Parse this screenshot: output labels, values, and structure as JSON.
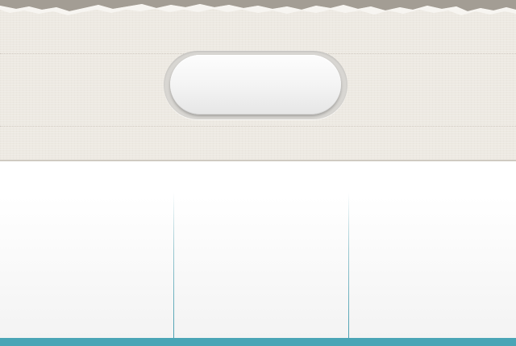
{
  "header": {
    "button_label": ""
  },
  "tabs": [
    {
      "label": ""
    },
    {
      "label": ""
    },
    {
      "label": ""
    }
  ],
  "colors": {
    "paper": "#ede9e2",
    "accent": "#4aa5b6",
    "divider": "#4aa0b2",
    "button": "#f4f4f4"
  }
}
